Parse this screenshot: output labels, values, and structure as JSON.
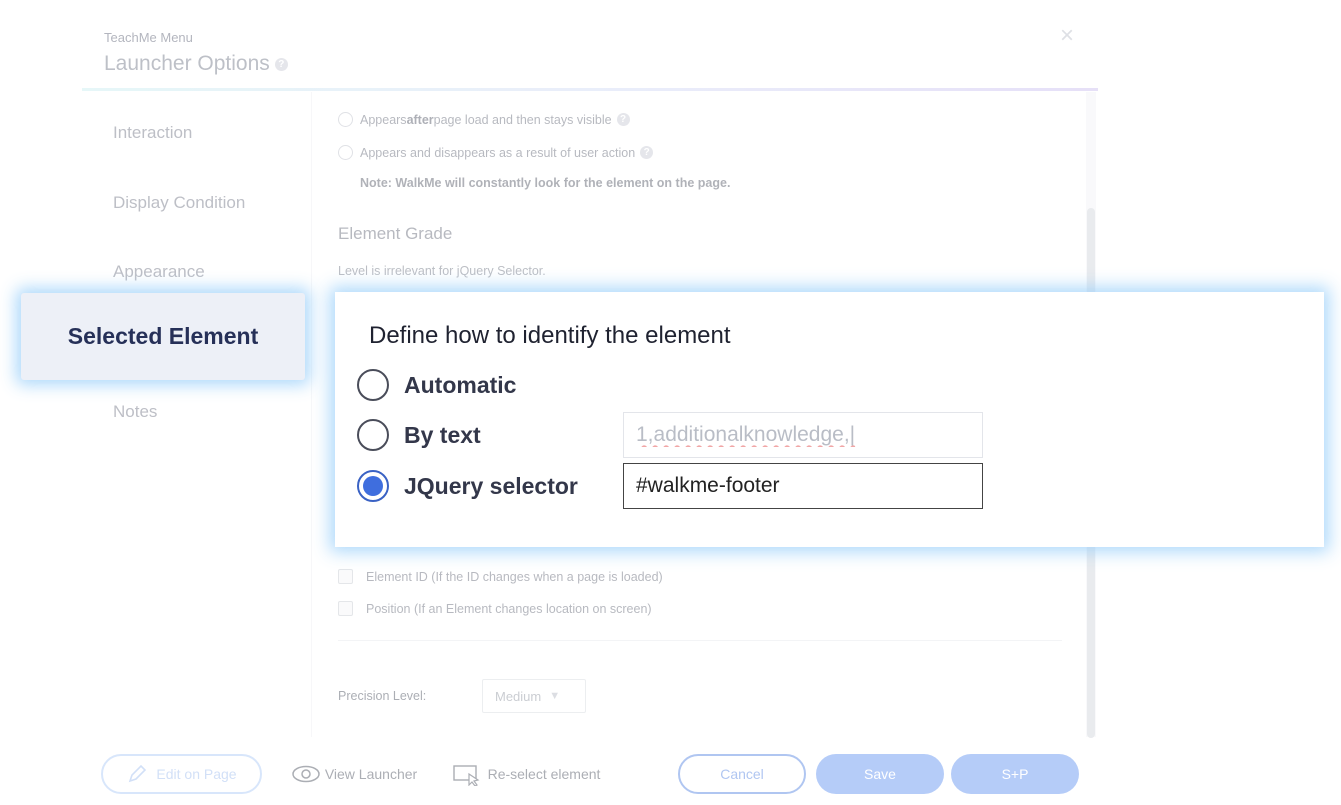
{
  "header": {
    "subtitle": "TeachMe Menu",
    "title": "Launcher Options",
    "help_icon": "question-circle-icon",
    "close_glyph": "×"
  },
  "sidebar": {
    "items": [
      {
        "label": "Interaction"
      },
      {
        "label": "Display Condition"
      },
      {
        "label": "Appearance"
      },
      {
        "label": "Selected Element",
        "active": true
      },
      {
        "label": "Notes"
      }
    ]
  },
  "visibility_options": [
    {
      "label_before": "Appears ",
      "label_bold": "after",
      "label_after": " page load and then stays visible"
    },
    {
      "label_before": "Appears and disappears as a result of user action",
      "label_bold": "",
      "label_after": ""
    }
  ],
  "visibility_note": "Note: WalkMe will constantly look for the element on the page.",
  "element_grade": {
    "heading": "Element Grade",
    "note": "Level is irrelevant for jQuery Selector."
  },
  "grade_checks": [
    {
      "label": "Element ID (If the ID changes when a page is loaded)"
    },
    {
      "label": "Position (If an Element changes location on screen)"
    }
  ],
  "precision": {
    "label": "Precision Level:",
    "value": "Medium"
  },
  "identify_panel": {
    "title": "Define how to identify the element",
    "options": [
      {
        "label": "Automatic",
        "checked": false
      },
      {
        "label": "By text",
        "checked": false
      },
      {
        "label": "JQuery selector",
        "checked": true
      }
    ],
    "by_text_value": "1,additionalknowledge,|",
    "jquery_value": "#walkme-footer"
  },
  "footer": {
    "edit_label": "Edit on Page",
    "view_label": "View Launcher",
    "reselect_label": "Re-select element",
    "cancel_label": "Cancel",
    "save_label": "Save",
    "sp_label": "S+P"
  },
  "colors": {
    "accent": "#3f6ede",
    "save_bg": "#5b8ef0",
    "highlight_glow": "#a0d2fa",
    "selected_text": "#263058"
  }
}
